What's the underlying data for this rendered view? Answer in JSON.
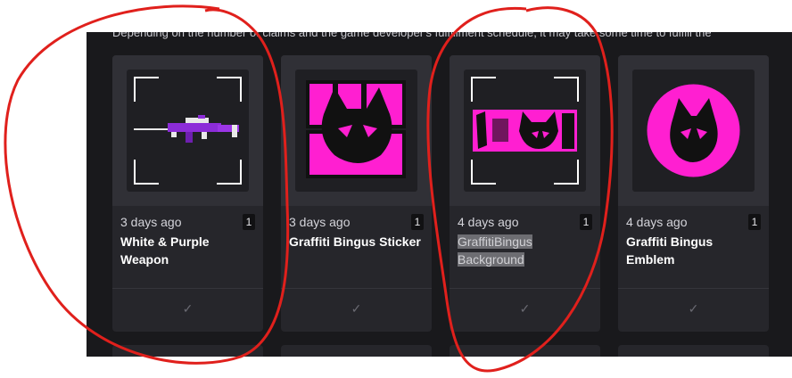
{
  "notice": "Depending on the number of claims and the game developer's fulfillment schedule, it may take some time to fulfill the",
  "items": [
    {
      "date": "3 days ago",
      "qty": "1",
      "name": "White & Purple Weapon",
      "check_icon": "check-icon"
    },
    {
      "date": "3 days ago",
      "qty": "1",
      "name": "Graffiti Bingus Sticker",
      "check_icon": "check-icon"
    },
    {
      "date": "4 days ago",
      "qty": "1",
      "name": "GraffitiBingus Background",
      "check_icon": "check-icon"
    },
    {
      "date": "4 days ago",
      "qty": "1",
      "name": "Graffiti Bingus Emblem",
      "check_icon": "check-icon"
    }
  ],
  "colors": {
    "accent": "#ff1fd1",
    "annotation": "#e0201c",
    "panel": "#19191c",
    "card": "#26262b"
  }
}
